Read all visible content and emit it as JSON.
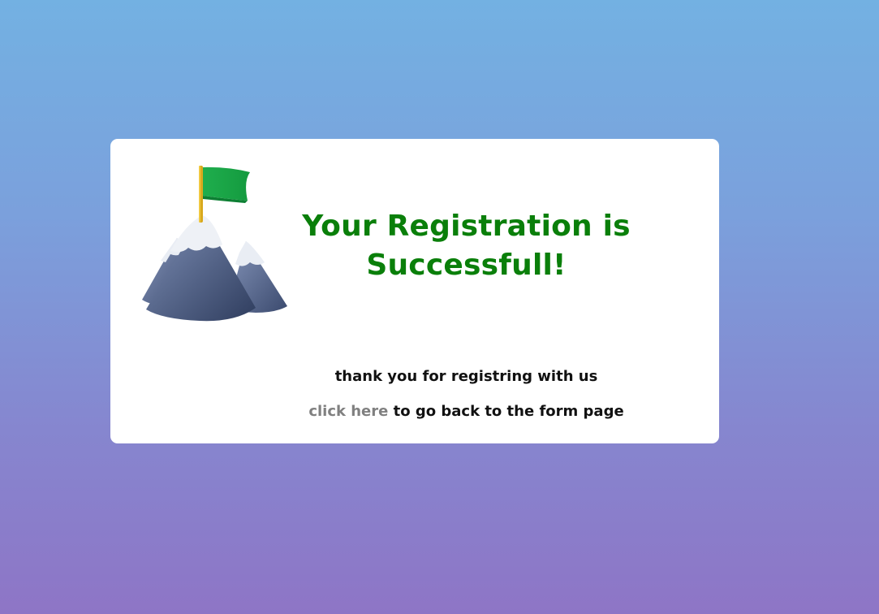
{
  "success_card": {
    "title_line1": "Your Registration is",
    "title_line2": "Successfull!",
    "illustration_icon": "mountain-flag-icon",
    "thanks_message": "thank you for registring with us",
    "back_link_label": "click here",
    "back_suffix": "to go back to the form page"
  },
  "colors": {
    "background_top": "#73b1e2",
    "background_bottom": "#8e75c6",
    "title": "#0a7f0a",
    "link": "#808080",
    "card": "#ffffff"
  }
}
